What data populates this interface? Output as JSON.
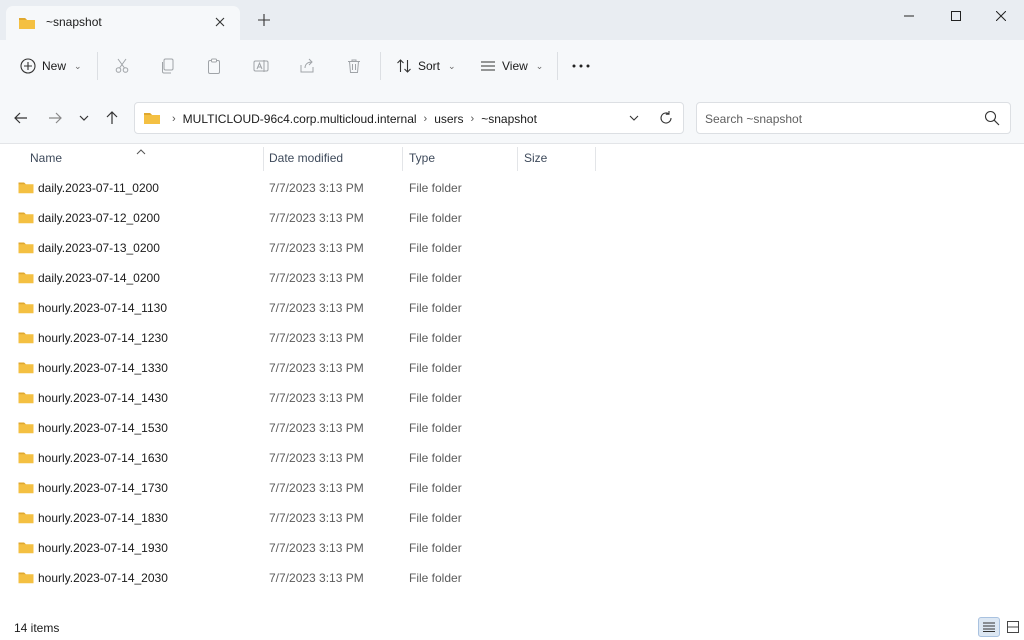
{
  "window": {
    "tab_title": "~snapshot"
  },
  "toolbar": {
    "new_label": "New",
    "sort_label": "Sort",
    "view_label": "View"
  },
  "address": {
    "crumbs": [
      "MULTICLOUD-96c4.corp.multicloud.internal",
      "users",
      "~snapshot"
    ]
  },
  "search": {
    "placeholder": "Search ~snapshot"
  },
  "columns": {
    "name": "Name",
    "date": "Date modified",
    "type": "Type",
    "size": "Size"
  },
  "files": [
    {
      "name": "daily.2023-07-11_0200",
      "date": "7/7/2023 3:13 PM",
      "type": "File folder"
    },
    {
      "name": "daily.2023-07-12_0200",
      "date": "7/7/2023 3:13 PM",
      "type": "File folder"
    },
    {
      "name": "daily.2023-07-13_0200",
      "date": "7/7/2023 3:13 PM",
      "type": "File folder"
    },
    {
      "name": "daily.2023-07-14_0200",
      "date": "7/7/2023 3:13 PM",
      "type": "File folder"
    },
    {
      "name": "hourly.2023-07-14_1130",
      "date": "7/7/2023 3:13 PM",
      "type": "File folder"
    },
    {
      "name": "hourly.2023-07-14_1230",
      "date": "7/7/2023 3:13 PM",
      "type": "File folder"
    },
    {
      "name": "hourly.2023-07-14_1330",
      "date": "7/7/2023 3:13 PM",
      "type": "File folder"
    },
    {
      "name": "hourly.2023-07-14_1430",
      "date": "7/7/2023 3:13 PM",
      "type": "File folder"
    },
    {
      "name": "hourly.2023-07-14_1530",
      "date": "7/7/2023 3:13 PM",
      "type": "File folder"
    },
    {
      "name": "hourly.2023-07-14_1630",
      "date": "7/7/2023 3:13 PM",
      "type": "File folder"
    },
    {
      "name": "hourly.2023-07-14_1730",
      "date": "7/7/2023 3:13 PM",
      "type": "File folder"
    },
    {
      "name": "hourly.2023-07-14_1830",
      "date": "7/7/2023 3:13 PM",
      "type": "File folder"
    },
    {
      "name": "hourly.2023-07-14_1930",
      "date": "7/7/2023 3:13 PM",
      "type": "File folder"
    },
    {
      "name": "hourly.2023-07-14_2030",
      "date": "7/7/2023 3:13 PM",
      "type": "File folder"
    }
  ],
  "status": {
    "item_count": "14 items"
  },
  "colors": {
    "folder": "#f4c042",
    "folder_dark": "#e0a82e",
    "titlebar_bg": "#e9edf2",
    "toolbar_bg": "#f6f8fa"
  }
}
